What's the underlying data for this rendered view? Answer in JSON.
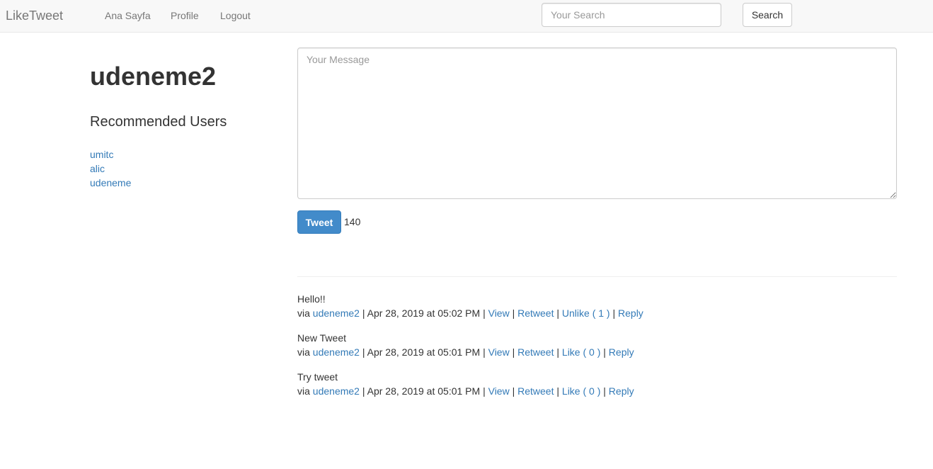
{
  "navbar": {
    "brand": "LikeTweet",
    "links": [
      {
        "label": "Ana Sayfa"
      },
      {
        "label": "Profile"
      },
      {
        "label": "Logout"
      }
    ],
    "search": {
      "placeholder": "Your Search",
      "value": "",
      "button_label": "Search"
    }
  },
  "sidebar": {
    "username": "udeneme2",
    "recommended_title": "Recommended Users",
    "recommended_users": [
      "umitc",
      "alic",
      "udeneme"
    ]
  },
  "composer": {
    "placeholder": "Your Message",
    "value": "",
    "button_label": "Tweet",
    "char_count": "140"
  },
  "feed": {
    "sep": " | ",
    "tweets": [
      {
        "text": "Hello!!",
        "via": "via ",
        "author": "udeneme2",
        "date": "Apr 28, 2019 at 05:02 PM",
        "view": "View",
        "retweet": "Retweet",
        "like": "Unlike ( 1 )",
        "reply": "Reply"
      },
      {
        "text": "New Tweet",
        "via": "via ",
        "author": "udeneme2",
        "date": "Apr 28, 2019 at 05:01 PM",
        "view": "View",
        "retweet": "Retweet",
        "like": "Like ( 0 )",
        "reply": "Reply"
      },
      {
        "text": "Try tweet",
        "via": "via ",
        "author": "udeneme2",
        "date": "Apr 28, 2019 at 05:01 PM",
        "view": "View",
        "retweet": "Retweet",
        "like": "Like ( 0 )",
        "reply": "Reply"
      }
    ]
  },
  "colors": {
    "link": "#337ab7",
    "primary": "#428bca",
    "navbar_bg": "#f8f8f8"
  }
}
